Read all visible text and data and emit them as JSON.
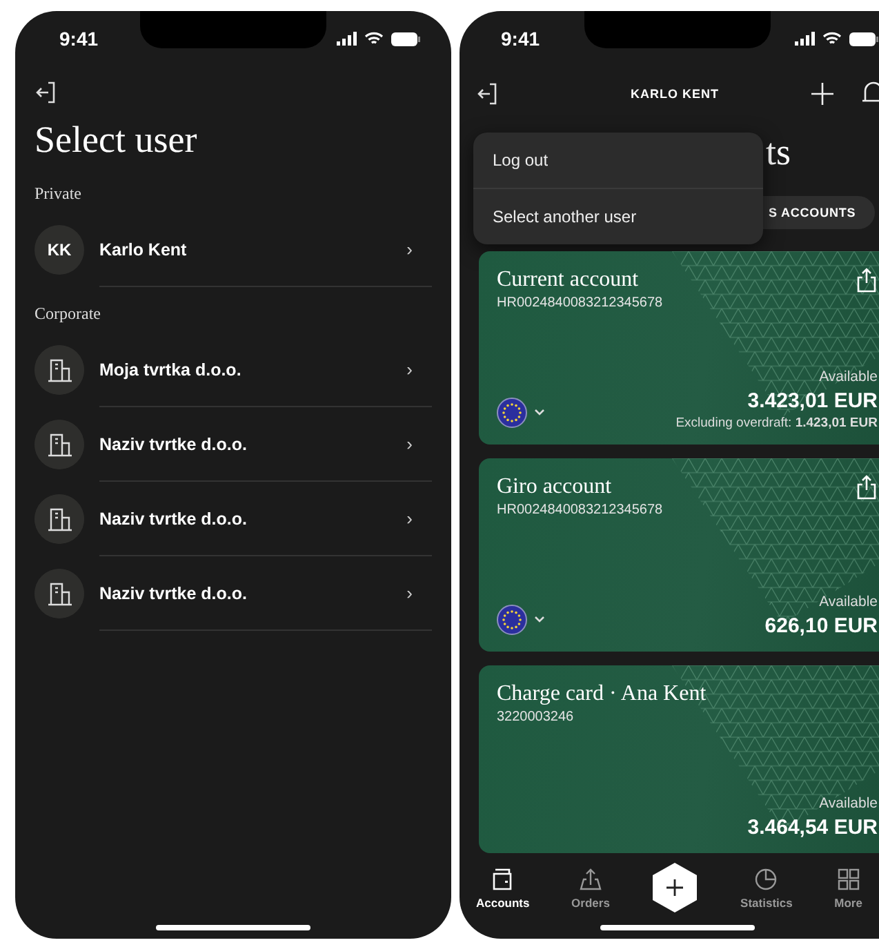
{
  "left_screen": {
    "status_bar": {
      "time": "9:41"
    },
    "title": "Select user",
    "sections": [
      {
        "heading": "Private",
        "users": [
          {
            "kind": "person",
            "initials": "KK",
            "name": "Karlo Kent",
            "chevron": "›"
          }
        ]
      },
      {
        "heading": "Corporate",
        "users": [
          {
            "kind": "company",
            "name": "Moja tvrtka d.o.o.",
            "chevron": "›"
          },
          {
            "kind": "company",
            "name": "Naziv tvrtke d.o.o.",
            "chevron": "›"
          },
          {
            "kind": "company",
            "name": "Naziv tvrtke d.o.o.",
            "chevron": "›"
          },
          {
            "kind": "company",
            "name": "Naziv tvrtke d.o.o.",
            "chevron": "›"
          }
        ]
      }
    ]
  },
  "right_screen": {
    "status_bar": {
      "time": "9:41"
    },
    "header_title": "KARLO KENT",
    "page_title": "ts",
    "tab_label": "S ACCOUNTS",
    "menu": [
      {
        "label": "Log out"
      },
      {
        "label": "Select another user"
      }
    ],
    "accounts": [
      {
        "name": "Current account",
        "number": "HR0024840083212345678",
        "currency_selector": true,
        "available_label": "Available",
        "amount": "3.423,01 EUR",
        "note": "Excluding overdraft: **1.423,01 EUR**"
      },
      {
        "name": "Giro account",
        "number": "HR0024840083212345678",
        "currency_selector": true,
        "available_label": "Available",
        "amount": "626,10 EUR"
      },
      {
        "name": "Charge card · Ana Kent",
        "number": "3220003246",
        "currency_selector": false,
        "available_label": "Available",
        "amount": "3.464,54 EUR"
      }
    ],
    "nav": [
      {
        "kind": "tab",
        "label": "Accounts",
        "selected": true
      },
      {
        "kind": "tab",
        "label": "Orders",
        "selected": false
      },
      {
        "kind": "action"
      },
      {
        "kind": "tab",
        "label": "Statistics",
        "selected": false
      },
      {
        "kind": "tab",
        "label": "More",
        "selected": false
      }
    ]
  }
}
